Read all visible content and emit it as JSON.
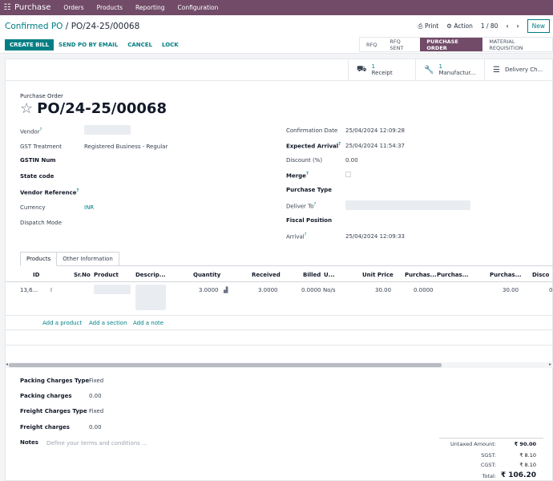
{
  "topbar": {
    "app": "Purchase",
    "menu": [
      "Orders",
      "Products",
      "Reporting",
      "Configuration"
    ]
  },
  "breadcrumb": {
    "parent": "Confirmed PO",
    "sep": "/",
    "current": "PO/24-25/00068"
  },
  "toolbar": {
    "print": "Print",
    "action": "Action",
    "pager": "1 / 80",
    "new": "New"
  },
  "actions": {
    "create_bill": "CREATE BILL",
    "send_po": "SEND PO BY EMAIL",
    "cancel": "CANCEL",
    "lock": "LOCK"
  },
  "status": [
    "RFQ",
    "RFQ SENT",
    "PURCHASE ORDER",
    "MATERIAL REQUISITION"
  ],
  "smart_buttons": [
    {
      "count": "1",
      "label": "Receipt"
    },
    {
      "count": "1",
      "label": "Manufactur..."
    },
    {
      "count": "",
      "label": "Delivery Ch..."
    }
  ],
  "header": {
    "type_label": "Purchase Order",
    "name": "PO/24-25/00068"
  },
  "left_fields": {
    "vendor": "Vendor",
    "gst_treatment": "GST Treatment",
    "gst_treatment_value": "Registered Business - Regular",
    "gstin": "GSTIN Num",
    "state_code": "State code",
    "vendor_ref": "Vendor Reference",
    "currency": "Currency",
    "currency_value": "INR",
    "dispatch_mode": "Dispatch Mode"
  },
  "right_fields": {
    "confirmation_date": "Confirmation Date",
    "confirmation_date_value": "25/04/2024 12:09:28",
    "expected_arrival": "Expected Arrival",
    "expected_arrival_value": "25/04/2024 11:54:37",
    "discount": "Discount (%)",
    "discount_value": "0.00",
    "merge": "Merge",
    "purchase_type": "Purchase Type",
    "deliver_to": "Deliver To",
    "fiscal_position": "Fiscal Position",
    "arrival": "Arrival",
    "arrival_value": "25/04/2024 12:09:33"
  },
  "tabs": [
    "Products",
    "Other Information"
  ],
  "table": {
    "headers": [
      "ID",
      "Sr.No",
      "Product",
      "Descrip...",
      "Quantity",
      "Received",
      "Billed",
      "U...",
      "Unit Price",
      "Purchas...",
      "Purchas...",
      "Purchas...",
      "Disco"
    ],
    "row": {
      "id": "13,6...",
      "quantity": "3.0000",
      "received": "3.0000",
      "billed": "0.0000",
      "uom": "No/s",
      "unit_price": "30.00",
      "purchase_1": "0.0000",
      "purchase_3": "30.00",
      "discount": "0"
    },
    "add_product": "Add a product",
    "add_section": "Add a section",
    "add_note": "Add a note"
  },
  "bottom": {
    "packing_type": "Packing Charges Type",
    "packing_type_value": "Fixed",
    "packing_charges": "Packing charges",
    "packing_charges_value": "0.00",
    "freight_type": "Freight Charges Type",
    "freight_type_value": "Fixed",
    "freight_charges": "Freight charges",
    "freight_charges_value": "0.00",
    "notes": "Notes",
    "notes_placeholder": "Define your terms and conditions ..."
  },
  "totals": {
    "untaxed_label": "Untaxed Amount:",
    "untaxed": "₹ 90.00",
    "sgst_label": "SGST:",
    "sgst": "₹ 8.10",
    "cgst_label": "CGST:",
    "cgst": "₹ 8.10",
    "total_label": "Total:",
    "total": "₹ 106.20"
  },
  "colors": {
    "brand": "#714B67",
    "accent": "#017e84"
  }
}
